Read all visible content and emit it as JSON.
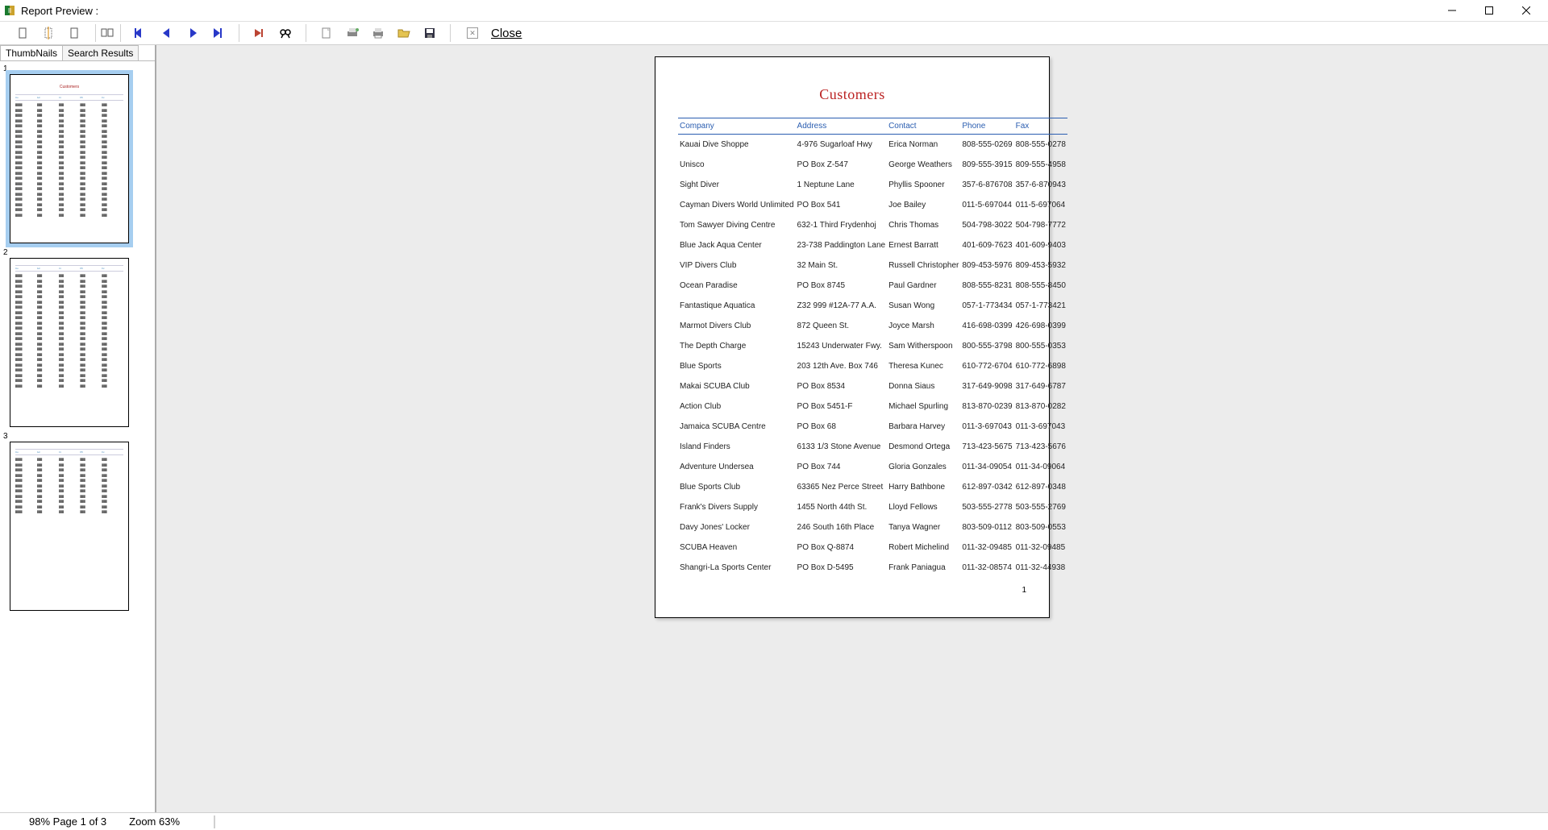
{
  "window": {
    "title": "Report Preview :"
  },
  "toolbar": {
    "close_label": "Close"
  },
  "sidebar": {
    "tabs": {
      "thumbnails": "ThumbNails",
      "search_results": "Search Results"
    },
    "thumb_count": 3
  },
  "report": {
    "title": "Customers",
    "columns": {
      "company": "Company",
      "address": "Address",
      "contact": "Contact",
      "phone": "Phone",
      "fax": "Fax"
    },
    "rows": [
      {
        "company": "Kauai Dive Shoppe",
        "address": "4-976 Sugarloaf Hwy",
        "contact": "Erica Norman",
        "phone": "808-555-0269",
        "fax": "808-555-0278"
      },
      {
        "company": "Unisco",
        "address": "PO Box Z-547",
        "contact": "George Weathers",
        "phone": "809-555-3915",
        "fax": "809-555-4958"
      },
      {
        "company": "Sight Diver",
        "address": "1 Neptune Lane",
        "contact": "Phyllis Spooner",
        "phone": "357-6-876708",
        "fax": "357-6-870943"
      },
      {
        "company": "Cayman Divers World Unlimited",
        "address": "PO Box 541",
        "contact": "Joe Bailey",
        "phone": "011-5-697044",
        "fax": "011-5-697064"
      },
      {
        "company": "Tom Sawyer Diving Centre",
        "address": "632-1 Third Frydenhoj",
        "contact": "Chris Thomas",
        "phone": "504-798-3022",
        "fax": "504-798-7772"
      },
      {
        "company": "Blue Jack Aqua Center",
        "address": "23-738 Paddington Lane",
        "contact": "Ernest Barratt",
        "phone": "401-609-7623",
        "fax": "401-609-9403"
      },
      {
        "company": "VIP Divers Club",
        "address": "32 Main St.",
        "contact": "Russell Christopher",
        "phone": "809-453-5976",
        "fax": "809-453-5932"
      },
      {
        "company": "Ocean Paradise",
        "address": "PO Box 8745",
        "contact": "Paul Gardner",
        "phone": "808-555-8231",
        "fax": "808-555-8450"
      },
      {
        "company": "Fantastique Aquatica",
        "address": "Z32 999 #12A-77 A.A.",
        "contact": "Susan Wong",
        "phone": "057-1-773434",
        "fax": "057-1-773421"
      },
      {
        "company": "Marmot Divers Club",
        "address": "872 Queen St.",
        "contact": "Joyce Marsh",
        "phone": "416-698-0399",
        "fax": "426-698-0399"
      },
      {
        "company": "The Depth Charge",
        "address": "15243 Underwater Fwy.",
        "contact": "Sam Witherspoon",
        "phone": "800-555-3798",
        "fax": "800-555-0353"
      },
      {
        "company": "Blue Sports",
        "address": "203 12th Ave. Box 746",
        "contact": "Theresa Kunec",
        "phone": "610-772-6704",
        "fax": "610-772-6898"
      },
      {
        "company": "Makai SCUBA Club",
        "address": "PO Box 8534",
        "contact": "Donna Siaus",
        "phone": "317-649-9098",
        "fax": "317-649-6787"
      },
      {
        "company": "Action Club",
        "address": "PO Box 5451-F",
        "contact": "Michael Spurling",
        "phone": "813-870-0239",
        "fax": "813-870-0282"
      },
      {
        "company": "Jamaica SCUBA Centre",
        "address": "PO Box 68",
        "contact": "Barbara Harvey",
        "phone": "011-3-697043",
        "fax": "011-3-697043"
      },
      {
        "company": "Island Finders",
        "address": "6133 1/3 Stone Avenue",
        "contact": "Desmond Ortega",
        "phone": "713-423-5675",
        "fax": "713-423-5676"
      },
      {
        "company": "Adventure Undersea",
        "address": "PO Box 744",
        "contact": "Gloria Gonzales",
        "phone": "011-34-09054",
        "fax": "011-34-09064"
      },
      {
        "company": "Blue Sports Club",
        "address": "63365 Nez Perce Street",
        "contact": "Harry Bathbone",
        "phone": "612-897-0342",
        "fax": "612-897-0348"
      },
      {
        "company": "Frank's Divers Supply",
        "address": "1455 North 44th St.",
        "contact": "Lloyd Fellows",
        "phone": "503-555-2778",
        "fax": "503-555-2769"
      },
      {
        "company": "Davy Jones' Locker",
        "address": "246 South 16th Place",
        "contact": "Tanya Wagner",
        "phone": "803-509-0112",
        "fax": "803-509-0553"
      },
      {
        "company": "SCUBA Heaven",
        "address": "PO Box Q-8874",
        "contact": "Robert Michelind",
        "phone": "011-32-09485",
        "fax": "011-32-09485"
      },
      {
        "company": "Shangri-La Sports Center",
        "address": "PO Box D-5495",
        "contact": "Frank Paniagua",
        "phone": "011-32-08574",
        "fax": "011-32-44938"
      }
    ],
    "page_number": "1"
  },
  "status": {
    "percent": "98%",
    "page": "Page 1 of 3",
    "zoom": "Zoom 63%"
  }
}
